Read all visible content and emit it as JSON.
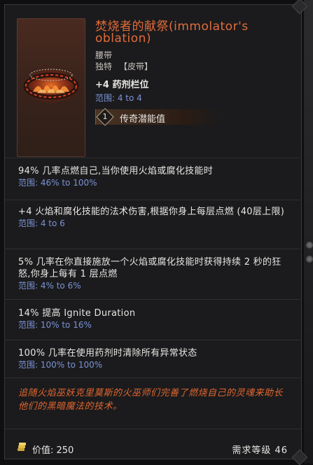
{
  "item": {
    "title": "焚烧者的献祭(immolator's oblation)",
    "type": "腰带",
    "rarity": "独特",
    "type_tag": "【皮带】",
    "main_stat": "+4 药剂栏位",
    "main_range": "范围: 4 to 4",
    "potential_count": "1",
    "potential_label": "传奇潜能值"
  },
  "affixes": [
    {
      "text": "94% 几率点燃自己,当你使用火焰或腐化技能时",
      "range": "范围: 46% to 100%"
    },
    {
      "text": "+4 火焰和腐化技能的法术伤害,根据你身上每层点燃 (40层上限)",
      "range": "范围: 4 to 6"
    },
    {
      "text": "5% 几率在你直接施放一个火焰或腐化技能时获得持续 2 秒的狂怒,你身上每有 1 层点燃",
      "range": "范围: 4% to 6%"
    },
    {
      "text": "14% 提高 Ignite Duration",
      "range": "范围: 10% to 16%"
    },
    {
      "text": "100% 几率在使用药剂时清除所有异常状态",
      "range": "范围: 100% to 100%"
    }
  ],
  "flavor": "追随火焰巫妖克里莫斯的火巫师们完善了燃烧自己的灵魂来助长他们的黑暗魔法的技术。",
  "footer": {
    "value_label": "价值: 250",
    "requirement_label": "需求等级 46"
  },
  "colors": {
    "title": "#e26c3a",
    "range": "#7b93d6",
    "flavor": "#e0662e"
  },
  "icons": [
    "belt-item-icon",
    "gold-coin-icon",
    "potential-diamond-icon"
  ]
}
